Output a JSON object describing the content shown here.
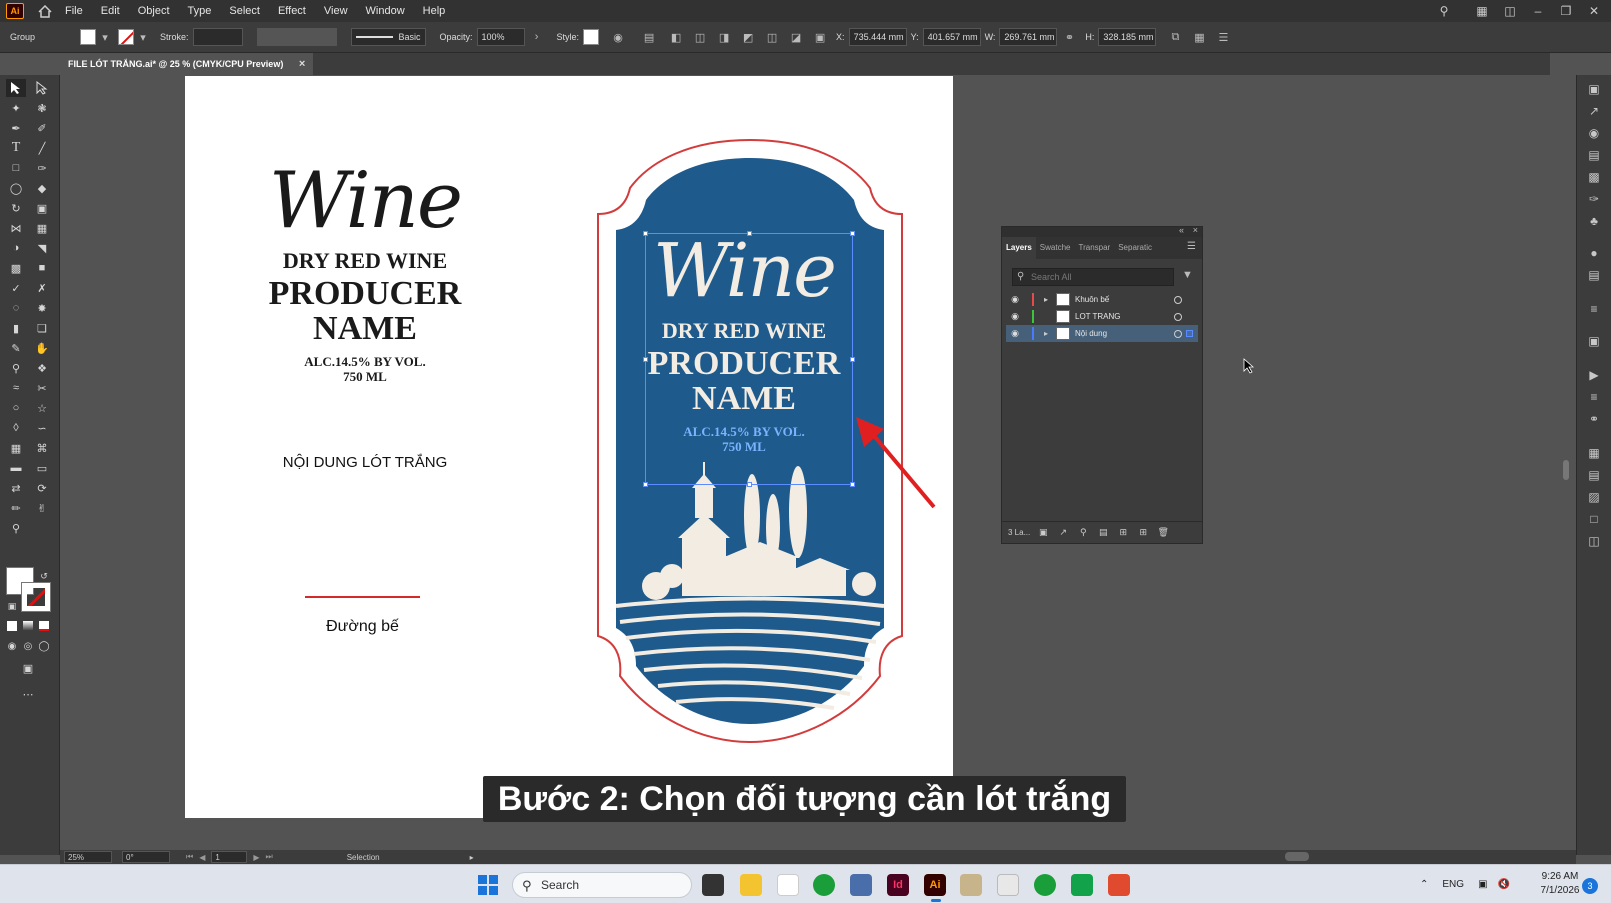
{
  "menubar": {
    "app_logo": "Ai",
    "items": [
      "File",
      "Edit",
      "Object",
      "Type",
      "Select",
      "Effect",
      "View",
      "Window",
      "Help"
    ]
  },
  "controlbar": {
    "selection_type": "Group",
    "stroke_label": "Stroke:",
    "brush_style": "Basic",
    "opacity_label": "Opacity:",
    "opacity_value": "100%",
    "style_label": "Style:",
    "x_label": "X:",
    "x_value": "735.444 mm",
    "y_label": "Y:",
    "y_value": "401.657 mm",
    "w_label": "W:",
    "w_value": "269.761 mm",
    "h_label": "H:",
    "h_value": "328.185 mm"
  },
  "document": {
    "tab_title": "FILE LÓT TRẮNG.ai* @ 25 % (CMYK/CPU Preview)",
    "close_glyph": "×"
  },
  "artboard": {
    "left": {
      "wine": "Wine",
      "dry_red": "DRY RED WINE",
      "producer": "PRODUCER",
      "name": "NAME",
      "alc": "ALC.14.5% BY VOL.",
      "volume": "750 ML",
      "note": "NỘI DUNG LÓT TRẮNG",
      "line_label": "Đường bế"
    },
    "label": {
      "wine": "Wine",
      "dry_red": "DRY RED WINE",
      "producer": "PRODUCER",
      "name": "NAME",
      "alc": "ALC.14.5% BY VOL.",
      "volume": "750 ML",
      "background_color": "#1f5a8c",
      "outline_color": "#d23c3c"
    }
  },
  "subtitle": "Bước 2: Chọn đối tượng cần lót trắng",
  "layers_panel": {
    "tabs": [
      "Layers",
      "Swatche",
      "Transpar",
      "Separatic"
    ],
    "active_tab": "Layers",
    "search_placeholder": "Search All",
    "layers": [
      {
        "name": "Khuôn bế",
        "color": "#e84a4a",
        "selected": false
      },
      {
        "name": "LOT TRANG",
        "color": "#3cc43c",
        "selected": false
      },
      {
        "name": "Nội dung",
        "color": "#4a7bff",
        "selected": true
      }
    ],
    "footer_count": "3 La..."
  },
  "statusbar": {
    "zoom": "25%",
    "rotation": "0°",
    "artboard_number": "1",
    "tool_name": "Selection"
  },
  "taskbar": {
    "search_placeholder": "Search",
    "language": "ENG",
    "time": "9:26 AM",
    "date": "7/1/2026",
    "notification_count": "3",
    "apps": [
      {
        "name": "Id",
        "color": "#49021f",
        "fg": "#ff3366"
      },
      {
        "name": "Ai",
        "color": "#330000",
        "fg": "#ff9a00"
      }
    ]
  }
}
